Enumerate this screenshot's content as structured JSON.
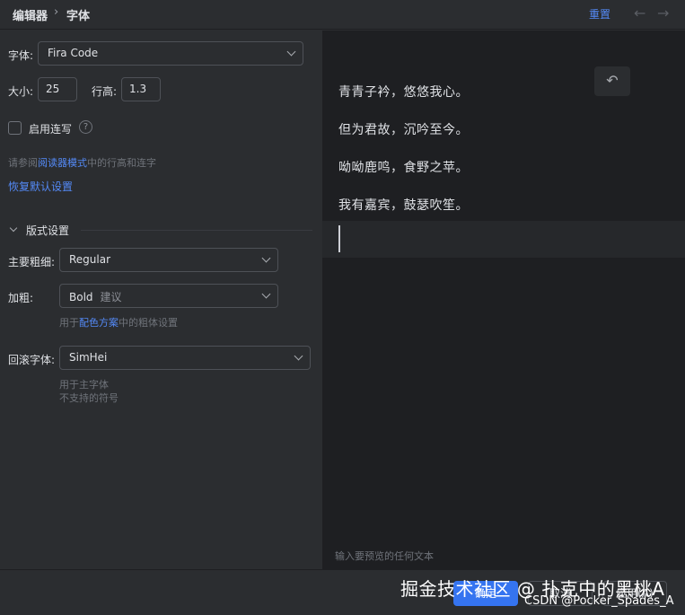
{
  "breadcrumb": {
    "parent": "编辑器",
    "separator": "›",
    "current": "字体"
  },
  "header": {
    "reset_label": "重置",
    "back_icon": "arrow-left-icon",
    "forward_icon": "arrow-right-icon"
  },
  "font": {
    "label": "字体:",
    "value": "Fira Code",
    "size_label": "大小:",
    "size_value": "25",
    "line_height_label": "行高:",
    "line_height_value": "1.3",
    "ligatures_label": "启用连写",
    "ligatures_checked": false,
    "hint_prefix": "请参阅",
    "hint_link": "阅读器模式",
    "hint_suffix": "中的行高和连字",
    "restore_label": "恢复默认设置"
  },
  "typography": {
    "section_title": "版式设置",
    "main_weight_label": "主要粗细:",
    "main_weight_value": "Regular",
    "bold_label": "加粗:",
    "bold_value": "Bold",
    "bold_suggest": "建议",
    "bold_hint_prefix": "用于",
    "bold_hint_link": "配色方案",
    "bold_hint_suffix": "中的粗体设置",
    "fallback_label": "回滚字体:",
    "fallback_value": "SimHei",
    "fallback_hint_1": "用于主字体",
    "fallback_hint_2": "不支持的符号"
  },
  "preview": {
    "lines": [
      "青青子衿，悠悠我心。",
      "但为君故，沉吟至今。",
      "呦呦鹿鸣，食野之苹。",
      "我有嘉宾，鼓瑟吹笙。"
    ],
    "placeholder": "输入要预览的任何文本",
    "undo_icon": "undo-icon"
  },
  "footer": {
    "ok_label": "确定",
    "cancel_label": "取消",
    "apply_label": "应用(A)"
  },
  "watermark": {
    "line1": "掘金技术社区 @ 扑克中的黑桃A",
    "line2": "CSDN @Pocker_Spades_A"
  },
  "colors": {
    "accent": "#3574f0",
    "link": "#548af7",
    "panel": "#2b2d30",
    "editor": "#1e1f22"
  }
}
